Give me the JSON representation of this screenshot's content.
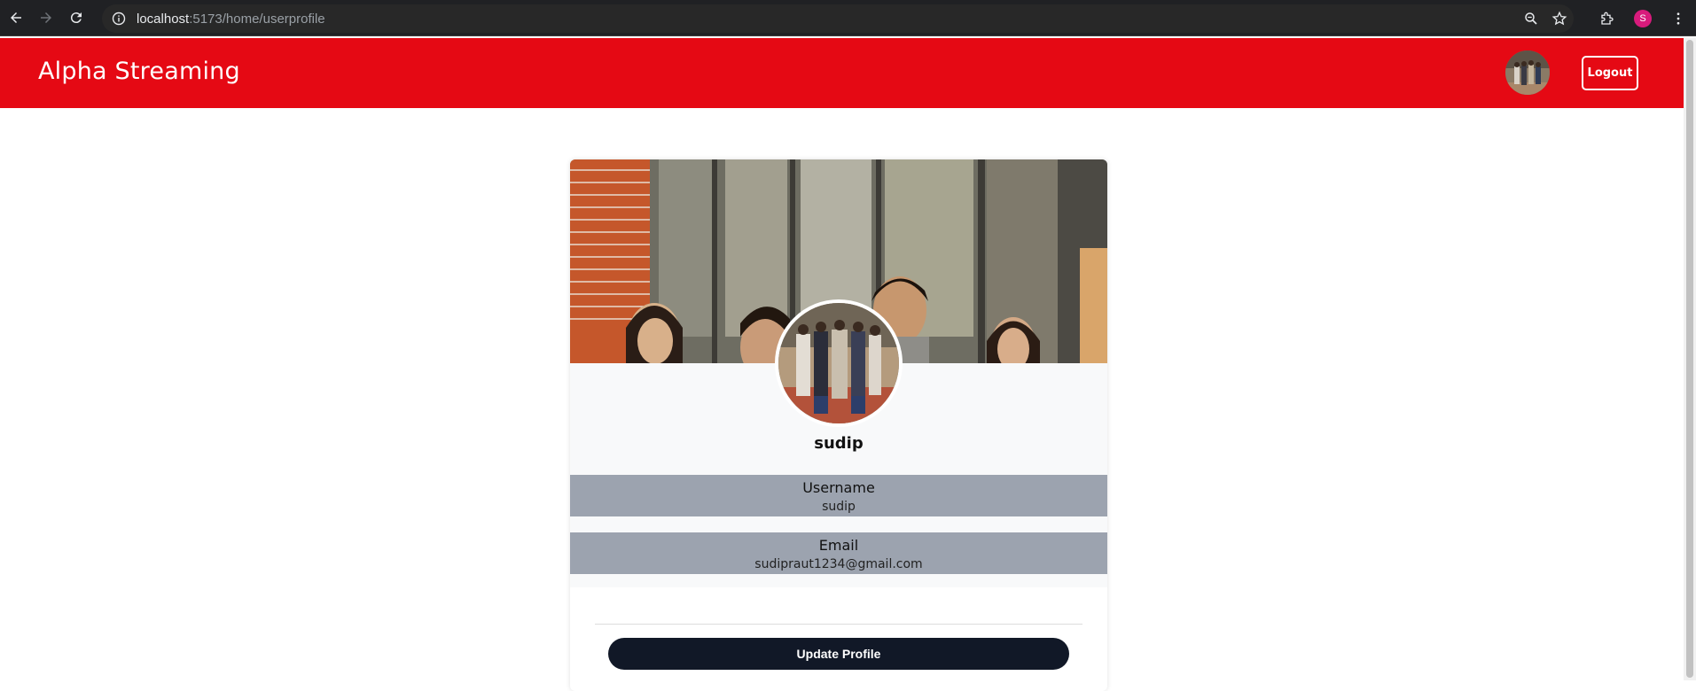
{
  "browser": {
    "url_host": "localhost",
    "url_path": ":5173/home/userprofile",
    "profile_initial": "S"
  },
  "header": {
    "brand": "Alpha Streaming",
    "logout_label": "Logout",
    "bg_color": "#e50914"
  },
  "profile": {
    "display_name": "sudip",
    "fields": [
      {
        "label": "Username",
        "value": "sudip"
      },
      {
        "label": "Email",
        "value": "sudipraut1234@gmail.com"
      }
    ],
    "update_button_label": "Update Profile"
  },
  "icons": {
    "back": "arrow-left-icon",
    "forward": "arrow-right-icon",
    "reload": "reload-icon",
    "site_info": "info-icon",
    "zoom": "zoom-icon",
    "bookmark": "star-icon",
    "extensions": "puzzle-icon",
    "menu": "kebab-menu-icon"
  }
}
